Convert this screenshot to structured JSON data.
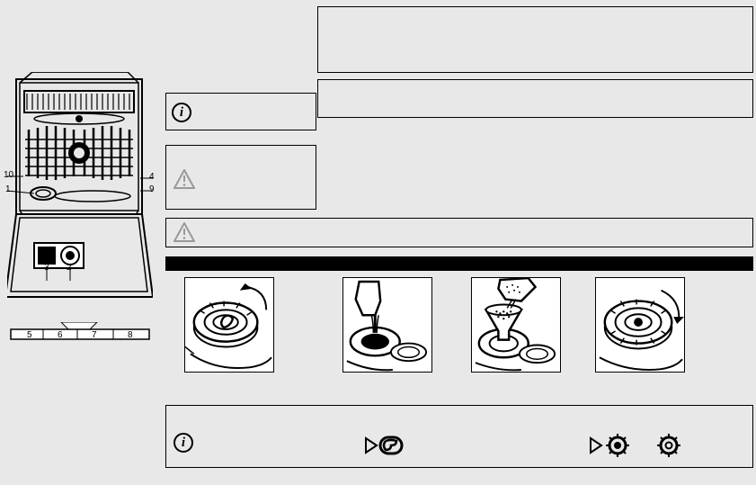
{
  "appliance_part_labels": {
    "n1": "1",
    "n2": "2",
    "n3": "3",
    "n4": "4",
    "n9": "9",
    "n10": "10",
    "p5": "5",
    "p6": "6",
    "p7": "7",
    "p8": "8"
  },
  "info_icon_glyph": "i",
  "footer": {
    "play_icon": "▶",
    "salt_icon": "S",
    "rinse_icon": "✺"
  }
}
